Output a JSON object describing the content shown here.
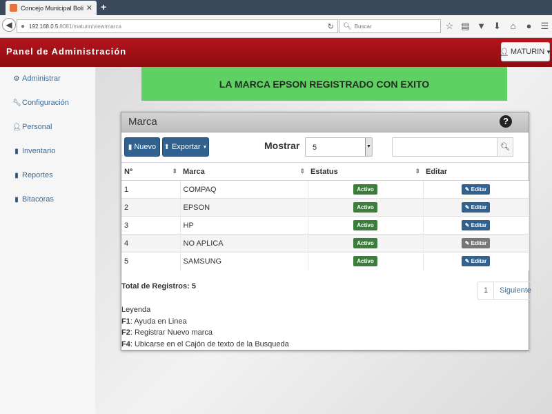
{
  "browser": {
    "tab_title": "Concejo Municipal Bolivariano ...",
    "new_tab": "+",
    "url_host": "192.168.0.5",
    "url_rest": ":8081/maturin/view/marca",
    "search_placeholder": "Buscar"
  },
  "header": {
    "title": "Panel de Administración",
    "user": "MATURIN"
  },
  "sidebar": {
    "items": [
      {
        "label": "Administrar",
        "icon": "gear-icon"
      },
      {
        "label": "Configuración",
        "icon": "wrench-icon"
      },
      {
        "label": "Personal",
        "icon": "user-icon"
      },
      {
        "label": "Inventario",
        "icon": "book-icon"
      },
      {
        "label": "Reportes",
        "icon": "file-icon"
      },
      {
        "label": "Bitacoras",
        "icon": "file-icon"
      }
    ]
  },
  "alert": {
    "message": "LA MARCA EPSON REGISTRADO CON EXITO",
    "color": "#5fd162"
  },
  "panel": {
    "title": "Marca",
    "new_label": "Nuevo",
    "export_label": "Exportar",
    "show_label": "Mostrar",
    "show_value": "5",
    "columns": [
      "Nº",
      "Marca",
      "Estatus",
      "Editar"
    ],
    "rows": [
      {
        "num": "1",
        "marca": "COMPAQ",
        "estatus": "Activo",
        "editar": "Editar",
        "edit_disabled": false
      },
      {
        "num": "2",
        "marca": "EPSON",
        "estatus": "Activo",
        "editar": "Editar",
        "edit_disabled": false
      },
      {
        "num": "3",
        "marca": "HP",
        "estatus": "Activo",
        "editar": "Editar",
        "edit_disabled": false
      },
      {
        "num": "4",
        "marca": "NO APLICA",
        "estatus": "Activo",
        "editar": "Editar",
        "edit_disabled": true
      },
      {
        "num": "5",
        "marca": "SAMSUNG",
        "estatus": "Activo",
        "editar": "Editar",
        "edit_disabled": false
      }
    ],
    "total_label": "Total de Registros: 5",
    "pager_page": "1",
    "pager_next": "Siguiente"
  },
  "legend": {
    "title": "Leyenda",
    "items": [
      {
        "key": "F1",
        "text": ": Ayuda en Linea"
      },
      {
        "key": "F2",
        "text": ": Registrar Nuevo marca"
      },
      {
        "key": "F4",
        "text": ": Ubicarse en el Cajón de texto de la Busqueda"
      }
    ]
  },
  "colors": {
    "header_red": "#a51116",
    "primary_blue": "#30618f",
    "active_green": "#3b7d3b"
  }
}
